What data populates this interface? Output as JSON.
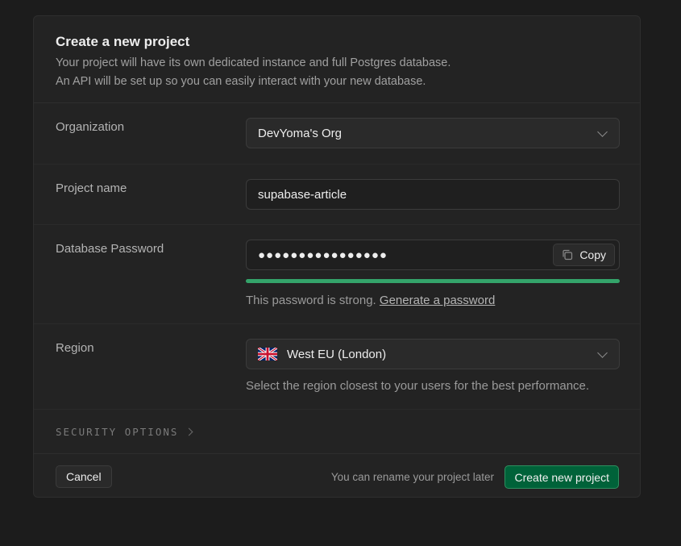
{
  "header": {
    "title": "Create a new project",
    "description_line1": "Your project will have its own dedicated instance and full Postgres database.",
    "description_line2": "An API will be set up so you can easily interact with your new database."
  },
  "organization": {
    "label": "Organization",
    "value": "DevYoma's Org",
    "icon": "chevron-down-icon"
  },
  "project_name": {
    "label": "Project name",
    "value": "supabase-article"
  },
  "database_password": {
    "label": "Database Password",
    "masked_value": "●●●●●●●●●●●●●●●●",
    "copy_label": "Copy",
    "copy_icon": "copy-icon",
    "strength_fraction": 1.0,
    "strength_color": "#34a46a",
    "strength_text": "This password is strong.",
    "generate_link": "Generate a password"
  },
  "region": {
    "label": "Region",
    "value": "West EU (London)",
    "flag_icon": "uk-flag-icon",
    "hint": "Select the region closest to your users for the best performance."
  },
  "security_options": {
    "label": "SECURITY OPTIONS",
    "icon": "chevron-right-icon"
  },
  "footer": {
    "cancel_label": "Cancel",
    "rename_note": "You can rename your project later",
    "create_label": "Create new project",
    "create_color": "#006239"
  }
}
